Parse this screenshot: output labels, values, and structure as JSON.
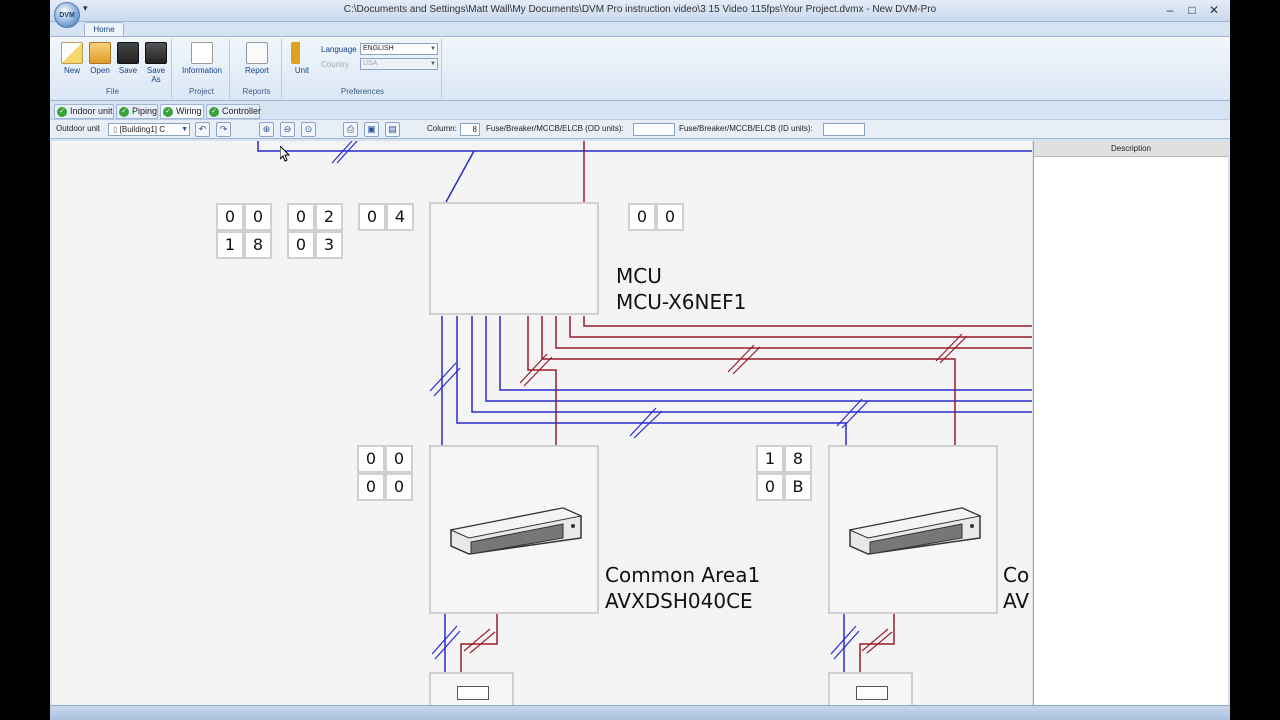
{
  "window": {
    "title": "C:\\Documents and Settings\\Matt Wall\\My Documents\\DVM Pro instruction video\\3 15 Video 115fps\\Your Project.dvmx - New DVM-Pro",
    "logo_text": "DVM",
    "minimize": "–",
    "maximize": "□",
    "close": "✕"
  },
  "ribbon": {
    "tab_home": "Home",
    "file_group": {
      "label": "File",
      "new": "New",
      "open": "Open",
      "save": "Save",
      "save_as": "Save As"
    },
    "project_group": {
      "label": "Project",
      "information": "Information"
    },
    "reports_group": {
      "label": "Reports",
      "report": "Report"
    },
    "preferences_group": {
      "label": "Preferences",
      "unit": "Unit",
      "language_label": "Language",
      "language_value": "ENGLISH",
      "country_label": "Country",
      "country_value": "USA"
    }
  },
  "doc_tabs": [
    "Indoor unit",
    "Piping",
    "Wiring",
    "Controller"
  ],
  "toolbar": {
    "outdoor_unit_label": "Outdoor unit",
    "outdoor_unit_value": "[Building1] C",
    "column_label": "Column:",
    "column_value": "8",
    "od_fuse_label": "Fuse/Breaker/MCCB/ELCB (OD units):",
    "od_fuse_value": "",
    "id_fuse_label": "Fuse/Breaker/MCCB/ELCB (ID units):",
    "id_fuse_value": ""
  },
  "description_panel": {
    "header": "Description"
  },
  "diagram": {
    "address_grids": [
      [
        "0",
        "0",
        "1",
        "8"
      ],
      [
        "0",
        "2",
        "0",
        "3"
      ]
    ],
    "address_single": [
      "0",
      "4"
    ],
    "mcu_address": [
      "0",
      "0"
    ],
    "mcu": {
      "name": "MCU",
      "model": "MCU-X6NEF1"
    },
    "unit1": {
      "address": [
        "0",
        "0",
        "0",
        "0"
      ],
      "name": "Common Area1",
      "model": "AVXDSH040CE"
    },
    "unit2": {
      "address": [
        "1",
        "8",
        "0",
        "B"
      ],
      "name": "Co",
      "model": "AV"
    }
  },
  "colors": {
    "comm_wire": "#2a2acf",
    "power_wire": "#9a1c2c"
  }
}
